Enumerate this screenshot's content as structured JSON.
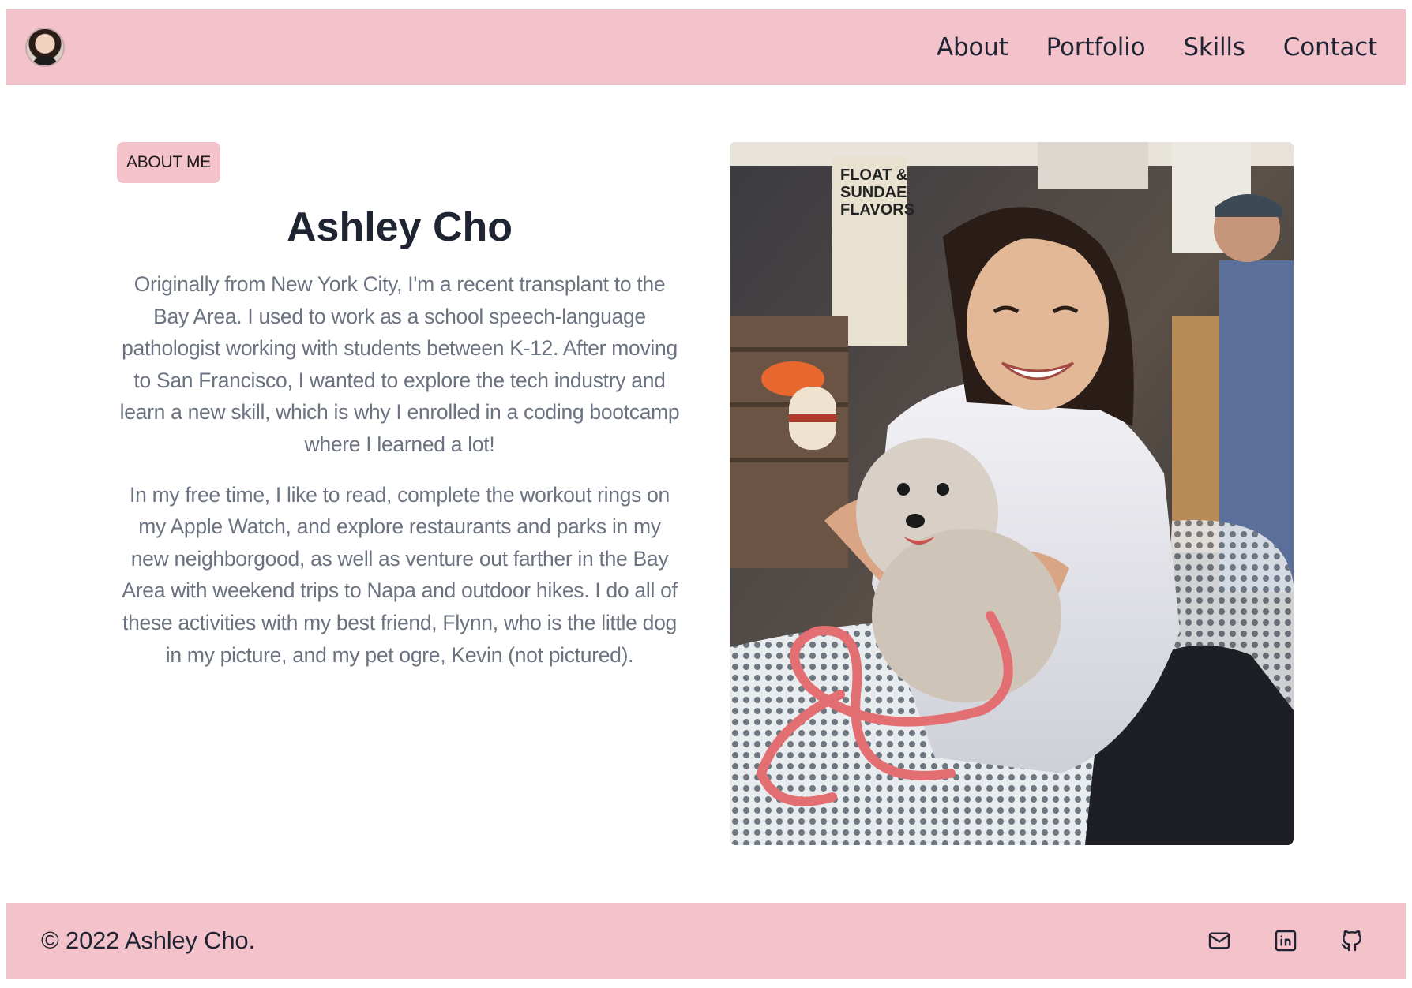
{
  "header": {
    "avatar_alt": "Ashley Cho avatar",
    "nav": [
      {
        "label": "About"
      },
      {
        "label": "Portfolio"
      },
      {
        "label": "Skills"
      },
      {
        "label": "Contact"
      }
    ]
  },
  "about": {
    "badge": "ABOUT ME",
    "name": "Ashley Cho",
    "paragraphs": [
      "Originally from New York City, I'm a recent transplant to the Bay Area. I used to work as a school speech-language pathologist working with students between K-12. After moving to San Francisco, I wanted to explore the tech industry and learn a new skill, which is why I enrolled in a coding bootcamp where I learned a lot!",
      "In my free time, I like to read, complete the workout rings on my Apple Watch, and explore restaurants and parks in my new neighborgood, as well as venture out farther in the Bay Area with weekend trips to Napa and outdoor hikes. I do all of these activities with my best friend, Flynn, who is the little dog in my picture, and my pet ogre, Kevin (not pictured)."
    ],
    "photo_sign_text": "FLOAT & SUNDAE FLAVORS"
  },
  "footer": {
    "copyright": "© 2022 Ashley Cho.",
    "social_icons": [
      "mail-icon",
      "linkedin-icon",
      "github-icon"
    ]
  },
  "colors": {
    "brand_pink": "#f4c2cb",
    "text_dark": "#1f2433",
    "text_muted": "#6b7280"
  }
}
